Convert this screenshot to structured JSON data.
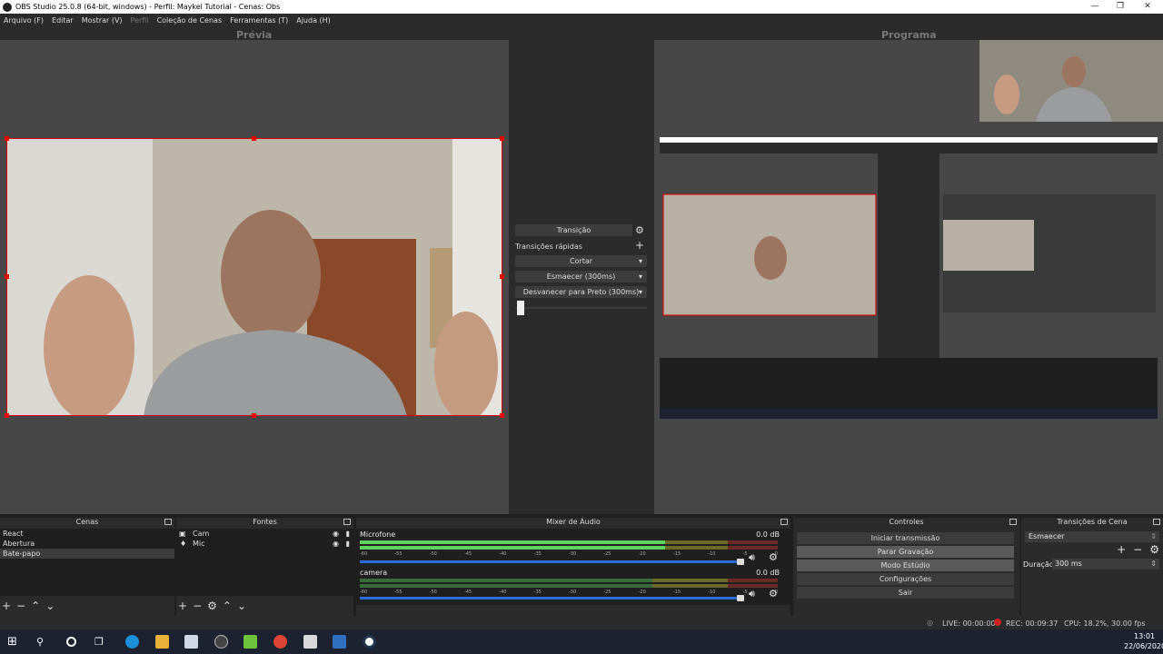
{
  "window": {
    "title": "OBS Studio 25.0.8 (64-bit, windows) - Perfil: Maykel Tutorial - Cenas: Obs",
    "minimize": "—",
    "maximize": "❐",
    "close": "✕"
  },
  "menu": [
    "Arquivo (F)",
    "Editar",
    "Mostrar (V)",
    "Perfil",
    "Coleção de Cenas",
    "Ferramentas (T)",
    "Ajuda (H)"
  ],
  "preview_label": "Prévia",
  "program_label": "Programa",
  "transitions_panel": {
    "transition_button": "Transição",
    "quick_transitions": "Transições rápidas",
    "items": [
      "Cortar",
      "Esmaecer (300ms)",
      "Desvanecer para Preto (300ms)"
    ]
  },
  "docks": {
    "scenes": {
      "title": "Cenas",
      "items": [
        "React",
        "Abertura",
        "Bate-papo"
      ],
      "selected": "Bate-papo"
    },
    "sources": {
      "title": "Fontes",
      "items": [
        "Cam",
        "Mic"
      ]
    },
    "mixer": {
      "title": "Mixer de Áudio",
      "channels": [
        {
          "name": "Microfone",
          "db": "0.0 dB",
          "level": 0.73
        },
        {
          "name": "camera",
          "db": "0.0 dB",
          "level": 0.0
        }
      ],
      "scale": [
        "-60",
        "-55",
        "-50",
        "-45",
        "-40",
        "-35",
        "-30",
        "-25",
        "-20",
        "-15",
        "-10",
        "-5",
        "0"
      ]
    },
    "controls": {
      "title": "Controles",
      "buttons": [
        "Iniciar transmissão",
        "Parar Gravação",
        "Modo Estúdio",
        "Configurações",
        "Sair"
      ]
    },
    "scene_transitions": {
      "title": "Transições de Cena",
      "selected": "Esmaecer",
      "duration_label": "Duração",
      "duration_value": "300 ms"
    }
  },
  "status": {
    "live": "LIVE: 00:00:00",
    "rec": "REC: 00:09:37",
    "cpu": "CPU: 18.2%, 30.00 fps"
  },
  "clock": {
    "time": "13:01",
    "date": "22/06/2020"
  },
  "colors": {
    "selection_red": "#dd0000",
    "meter_green": "#5fd35f",
    "volume_blue": "#2a6cd6",
    "rec_red": "#cc2222"
  }
}
